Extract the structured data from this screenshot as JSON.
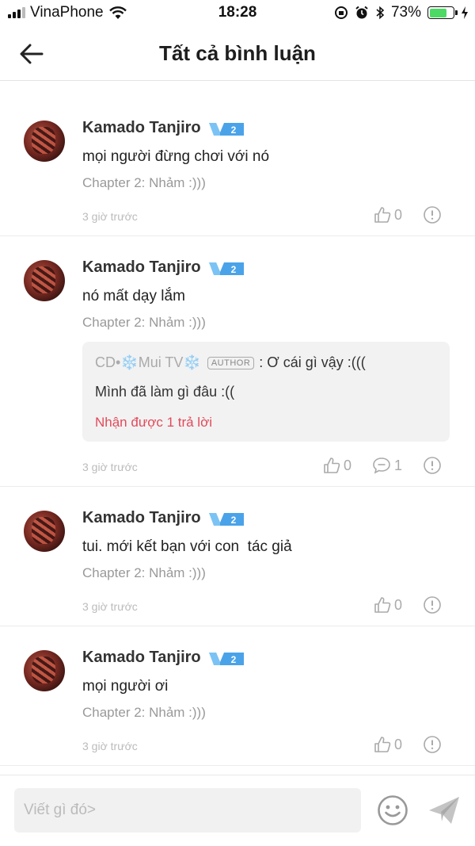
{
  "status_bar": {
    "carrier": "VinaPhone",
    "time": "18:28",
    "battery_percent": "73%",
    "battery_level": 0.73
  },
  "header": {
    "title": "Tất cả bình luận"
  },
  "comments": [
    {
      "author": "Kamado Tanjiro",
      "badge": "2",
      "content": "mọi người đừng chơi với nó",
      "chapter": "Chapter 2: Nhảm :)))",
      "time": "3 giờ trước",
      "likes": "0"
    },
    {
      "author": "Kamado Tanjiro",
      "badge": "2",
      "content": "nó mất dạy lắm",
      "chapter": "Chapter 2: Nhảm :)))",
      "time": "3 giờ trước",
      "likes": "0",
      "replies": "1",
      "reply": {
        "author": "CD•❄️Mui TV❄️",
        "author_tag": "AUTHOR",
        "text": ": Ơ cái gì vậy :(((",
        "text2": "Mình đã làm gì đâu :((",
        "reply_count": "Nhận được 1 trả lời"
      }
    },
    {
      "author": "Kamado Tanjiro",
      "badge": "2",
      "content": "tui. mới kết bạn với con  tác giả",
      "chapter": "Chapter 2: Nhảm :)))",
      "time": "3 giờ trước",
      "likes": "0"
    },
    {
      "author": "Kamado Tanjiro",
      "badge": "2",
      "content": "mọi người ơi",
      "chapter": "Chapter 2: Nhảm :)))",
      "time": "3 giờ trước",
      "likes": "0"
    }
  ],
  "composer": {
    "placeholder": "Viết gì đó>"
  },
  "colors": {
    "accent_red": "#e24a5a",
    "vip_blue": "#4aa3e8"
  }
}
